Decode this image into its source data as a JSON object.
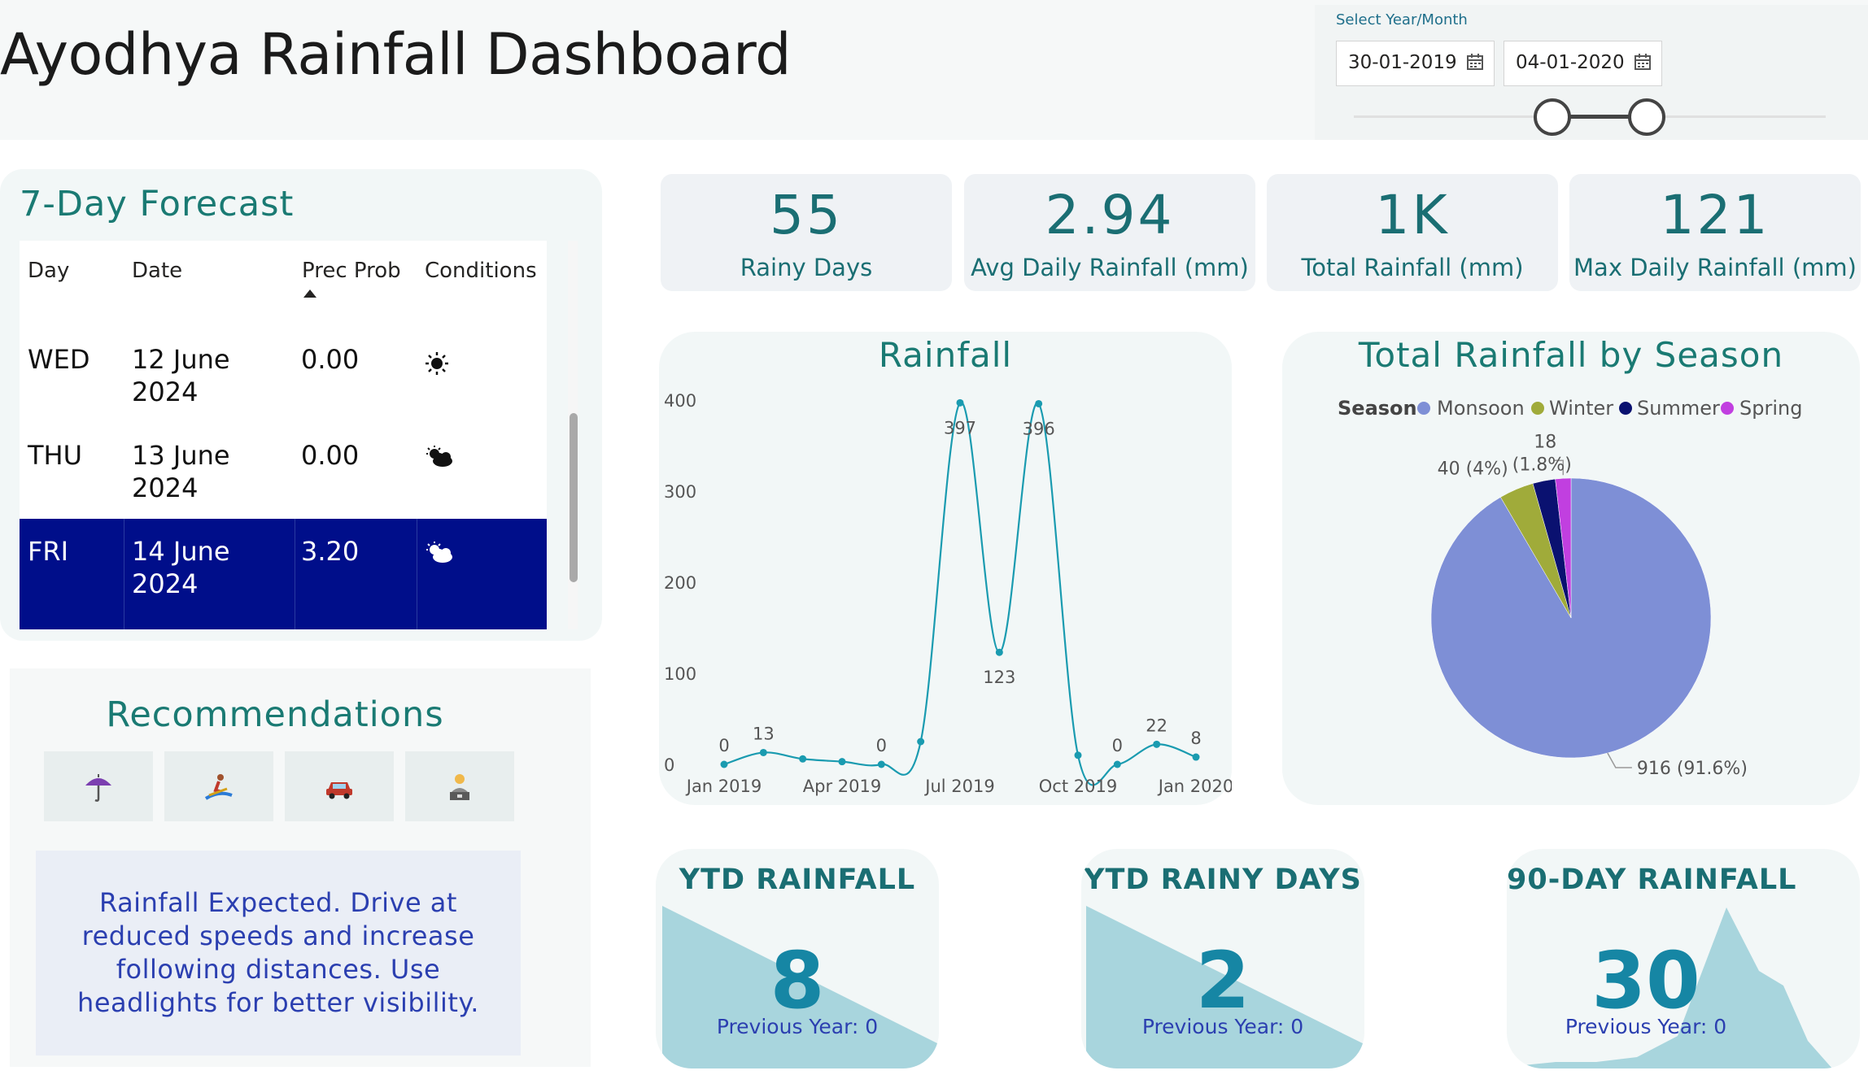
{
  "title": "Ayodhya Rainfall Dashboard",
  "filter": {
    "label": "Select Year/Month",
    "start_date": "30-01-2019",
    "end_date": "04-01-2020",
    "start_fraction": 0.42,
    "end_fraction": 0.62
  },
  "forecast": {
    "title": "7-Day Forecast",
    "columns": [
      "Day",
      "Date",
      "Prec Prob",
      "Conditions"
    ],
    "sorted_column": "Prec Prob",
    "rows": [
      {
        "day": "WED",
        "date_line1": "12 June",
        "date_line2": "2024",
        "prec": "0.00",
        "icon": "sun-icon",
        "selected": false
      },
      {
        "day": "THU",
        "date_line1": "13 June",
        "date_line2": "2024",
        "prec": "0.00",
        "icon": "partly-cloudy-icon",
        "selected": false
      },
      {
        "day": "FRI",
        "date_line1": "14 June",
        "date_line2": "2024",
        "prec": "3.20",
        "icon": "partly-cloudy-icon",
        "selected": true
      }
    ]
  },
  "kpis": [
    {
      "value": "55",
      "label": "Rainy Days"
    },
    {
      "value": "2.94",
      "label": "Avg Daily Rainfall (mm)"
    },
    {
      "value": "1K",
      "label": "Total Rainfall (mm)"
    },
    {
      "value": "121",
      "label": "Max Daily Rainfall (mm)"
    }
  ],
  "recommendations": {
    "title": "Recommendations",
    "icons": [
      "umbrella-icon",
      "surfer-icon",
      "car-icon",
      "office-worker-icon"
    ],
    "message": "Rainfall Expected. Drive at reduced speeds and increase following distances. Use headlights for better visibility."
  },
  "colors": {
    "accent": "#1a7a73",
    "line": "#1a9bb0",
    "selected_row": "#000e8a",
    "monsoon": "#7e8fd6",
    "winter": "#a0ab3a",
    "summer": "#0a1170",
    "spring": "#c13fe0",
    "area": "#a8d5dd"
  },
  "chart_data": [
    {
      "type": "line",
      "title": "Rainfall",
      "x": [
        "Jan 2019",
        "Feb 2019",
        "Mar 2019",
        "Apr 2019",
        "May 2019",
        "Jun 2019",
        "Jul 2019",
        "Aug 2019",
        "Sep 2019",
        "Oct 2019",
        "Nov 2019",
        "Dec 2019",
        "Jan 2020"
      ],
      "series": [
        {
          "values": [
            0,
            13,
            6,
            3,
            0,
            25,
            397,
            123,
            396,
            10,
            0,
            22,
            8
          ]
        }
      ],
      "data_labels": {
        "0": "0",
        "1": "13",
        "4": "0",
        "6": "397",
        "7": "123",
        "8": "396",
        "10": "0",
        "11": "22",
        "12": "8"
      },
      "x_tick_labels": [
        "Jan 2019",
        "Apr 2019",
        "Jul 2019",
        "Oct 2019",
        "Jan 2020"
      ],
      "y_ticks": [
        0,
        100,
        200,
        300,
        400
      ],
      "ylim": [
        0,
        400
      ],
      "grid": false
    },
    {
      "type": "pie",
      "title": "Total Rainfall by Season",
      "legend_title": "Season",
      "legend_position": "top",
      "slices": [
        {
          "name": "Monsoon",
          "value": 916,
          "label": "916 (91.6%)"
        },
        {
          "name": "Winter",
          "value": 40,
          "label": "40 (4%)"
        },
        {
          "name": "Summer",
          "value": 26,
          "label": ""
        },
        {
          "name": "Spring",
          "value": 18,
          "label": "18 (1.8%)"
        }
      ]
    }
  ],
  "bottom_cards": [
    {
      "title": "YTD RAINFALL",
      "value": "8",
      "prev": "Previous Year: 0",
      "shape": "descending-triangle"
    },
    {
      "title": "YTD RAINY DAYS",
      "value": "2",
      "prev": "Previous Year: 0",
      "shape": "descending-triangle"
    },
    {
      "title": "90-DAY RAINFALL",
      "value": "30",
      "prev": "Previous Year: 0",
      "shape": "peaks"
    }
  ]
}
